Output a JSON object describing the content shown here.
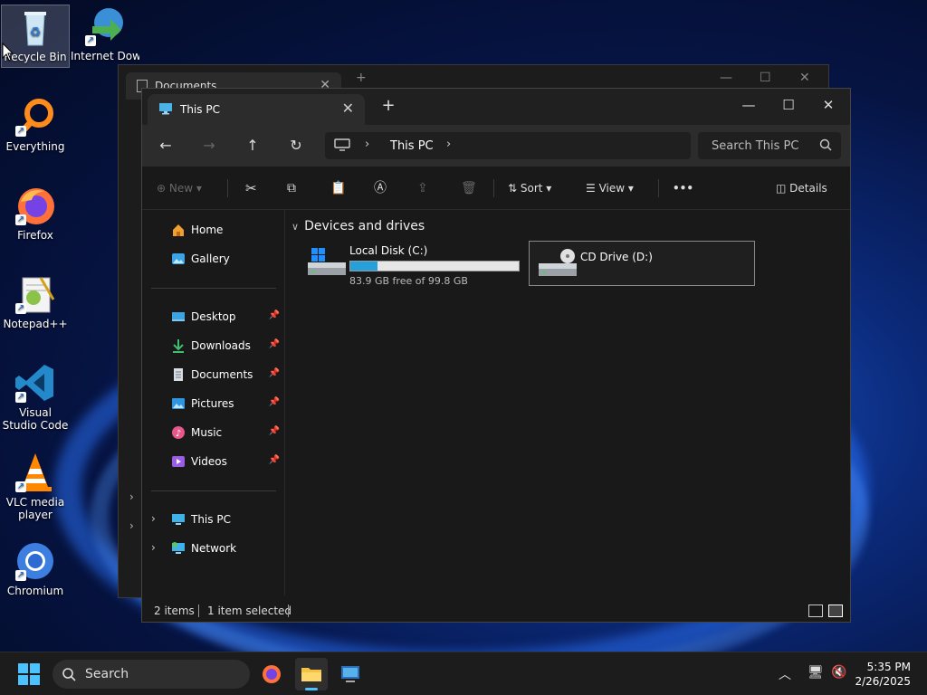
{
  "desktop": {
    "icons": [
      {
        "label": "Recycle Bin"
      },
      {
        "label": "Internet Downlo"
      },
      {
        "label": "Everything"
      },
      {
        "label": "Firefox"
      },
      {
        "label": "Notepad++"
      },
      {
        "label": "Visual Studio Code"
      },
      {
        "label": "VLC media player"
      },
      {
        "label": "Chromium"
      }
    ]
  },
  "background_window": {
    "tab_title": "Documents"
  },
  "explorer": {
    "tab_title": "This PC",
    "address": {
      "crumb": "This PC"
    },
    "search": {
      "placeholder": "Search This PC"
    },
    "toolbar": {
      "new_label": "New",
      "sort_label": "Sort",
      "view_label": "View",
      "more_label": "•••",
      "details_label": "Details"
    },
    "sidebar": {
      "top": [
        {
          "label": "Home"
        },
        {
          "label": "Gallery"
        }
      ],
      "quick": [
        {
          "label": "Desktop"
        },
        {
          "label": "Downloads"
        },
        {
          "label": "Documents"
        },
        {
          "label": "Pictures"
        },
        {
          "label": "Music"
        },
        {
          "label": "Videos"
        }
      ],
      "tree": [
        {
          "label": "This PC"
        },
        {
          "label": "Network"
        }
      ]
    },
    "group_title": "Devices and drives",
    "drives": [
      {
        "name": "Local Disk (C:)",
        "free_text": "83.9 GB free of 99.8 GB",
        "used_fraction": 0.16
      },
      {
        "name": "CD Drive (D:)"
      }
    ],
    "status": {
      "items": "2 items",
      "selected": "1 item selected"
    }
  },
  "taskbar": {
    "search_label": "Search",
    "time": "5:35 PM",
    "date": "2/26/2025"
  },
  "colors": {
    "accent": "#4cc2ff",
    "drive_bar": "#26a0da"
  }
}
